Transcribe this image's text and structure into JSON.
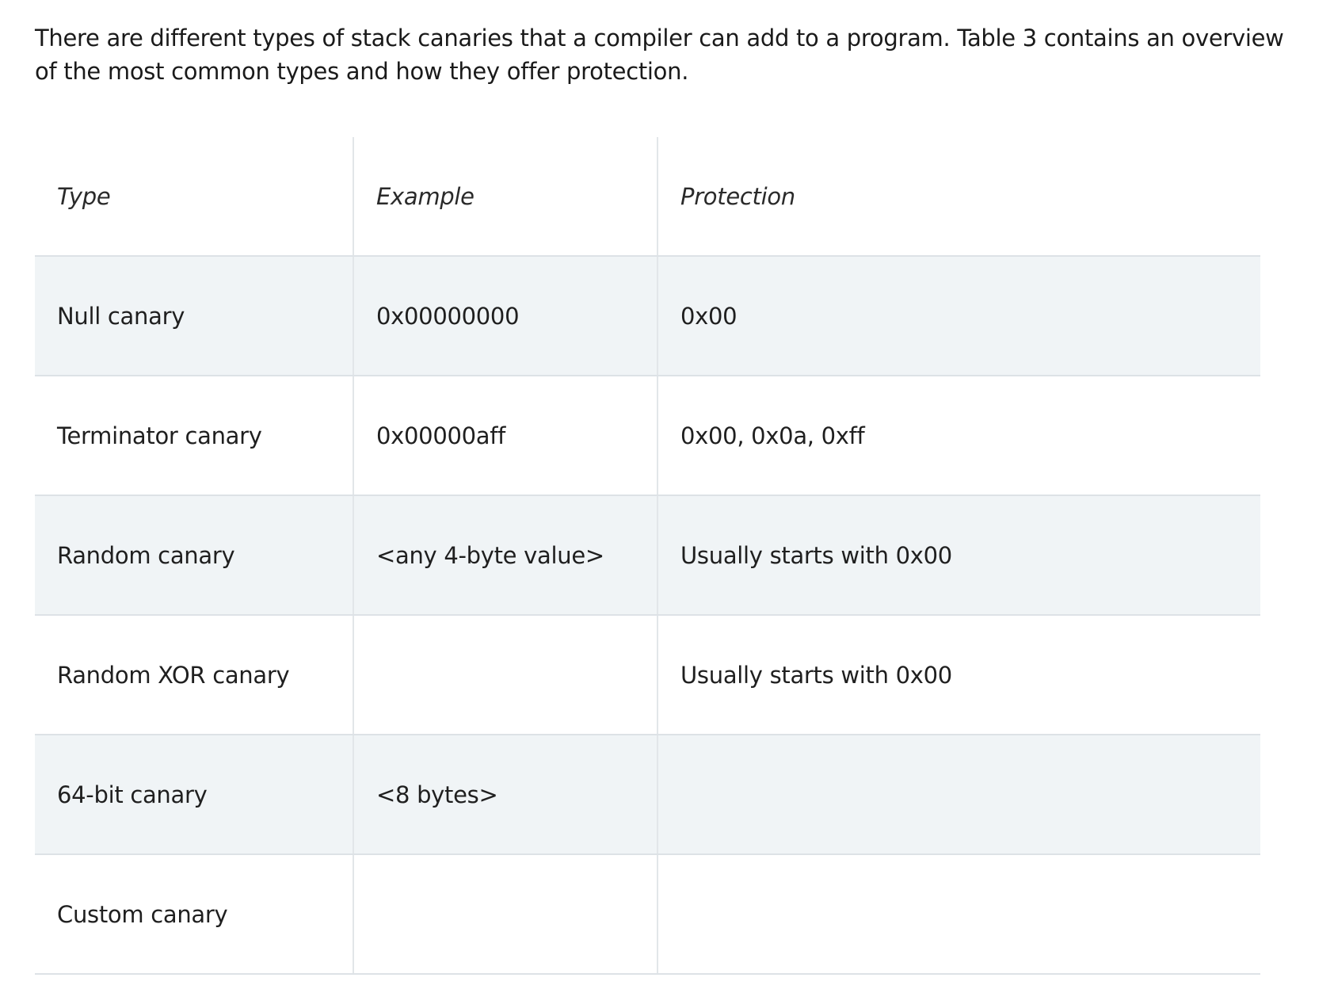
{
  "intro_text": "There are different types of stack canaries that a compiler can add to a program. Table 3 contains an overview of the most common types and how they offer protection.",
  "table": {
    "headers": {
      "type": "Type",
      "example": "Example",
      "protection": "Protection"
    },
    "rows": [
      {
        "type": "Null canary",
        "example": "0x00000000",
        "protection": "0x00"
      },
      {
        "type": "Terminator canary",
        "example": "0x00000aff",
        "protection": "0x00, 0x0a, 0xff"
      },
      {
        "type": "Random canary",
        "example": "<any 4-byte value>",
        "protection": "Usually starts with 0x00"
      },
      {
        "type": "Random XOR canary",
        "example": "",
        "protection": "Usually starts with 0x00"
      },
      {
        "type": "64-bit canary",
        "example": "<8 bytes>",
        "protection": ""
      },
      {
        "type": "Custom canary",
        "example": "",
        "protection": ""
      }
    ]
  },
  "colors": {
    "shaded_row": "#f0f4f6",
    "border": "#dde2e6",
    "text": "#1f1f1f"
  }
}
